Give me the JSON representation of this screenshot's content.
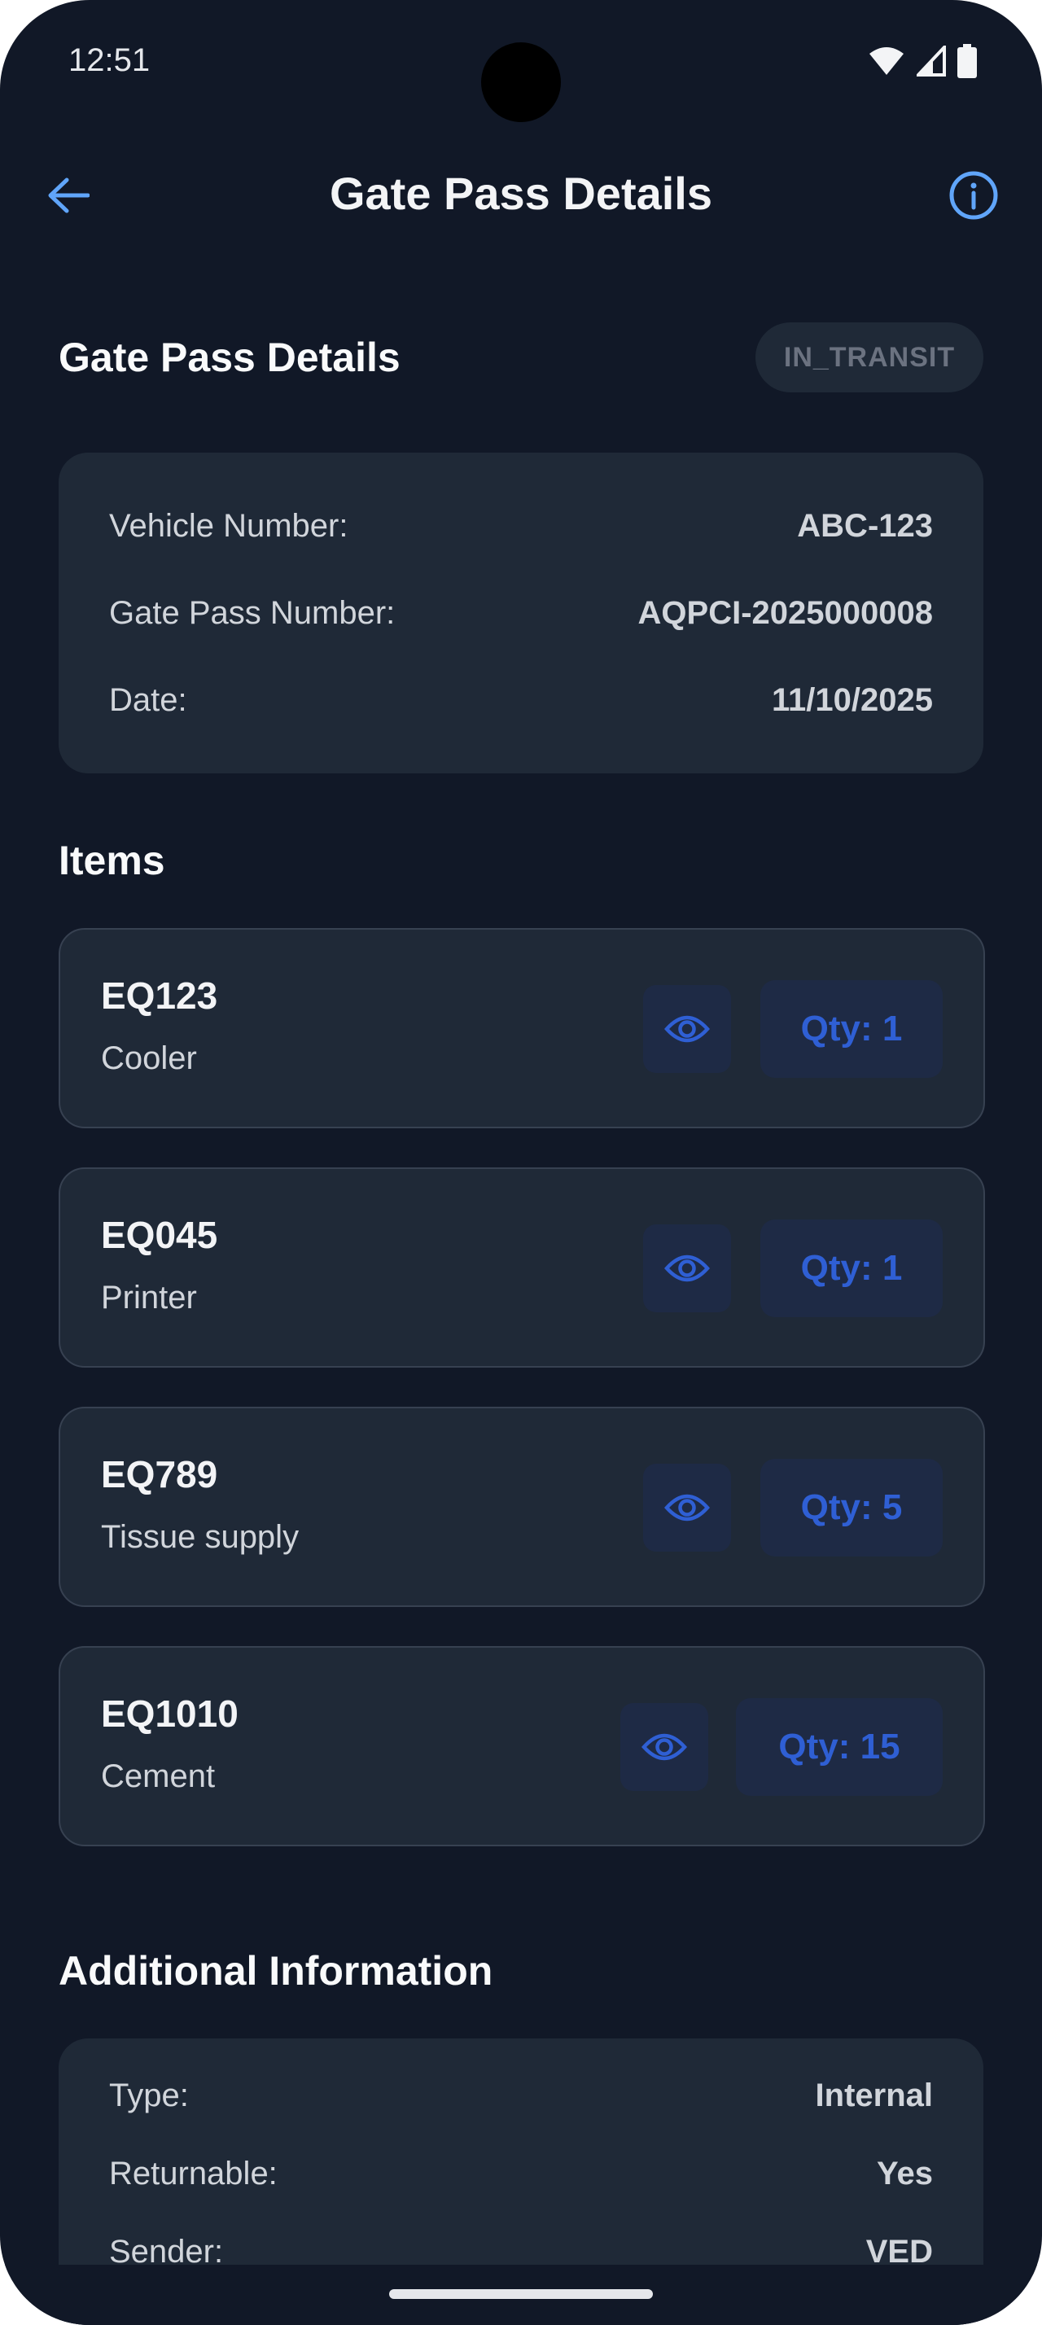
{
  "status_bar": {
    "time": "12:51"
  },
  "app_bar": {
    "title": "Gate Pass Details"
  },
  "header": {
    "title": "Gate Pass Details",
    "status": "IN_TRANSIT"
  },
  "details": [
    {
      "label": "Vehicle Number:",
      "value": "ABC-123"
    },
    {
      "label": "Gate Pass Number:",
      "value": "AQPCI-2025000008"
    },
    {
      "label": "Date:",
      "value": "11/10/2025"
    }
  ],
  "items_section": {
    "title": "Items"
  },
  "items": [
    {
      "code": "EQ123",
      "name": "Cooler",
      "qty": "Qty: 1"
    },
    {
      "code": "EQ045",
      "name": "Printer",
      "qty": "Qty: 1"
    },
    {
      "code": "EQ789",
      "name": "Tissue supply",
      "qty": "Qty: 5"
    },
    {
      "code": "EQ1010",
      "name": "Cement",
      "qty": "Qty: 15"
    }
  ],
  "additional_section": {
    "title": "Additional Information"
  },
  "additional": [
    {
      "label": "Type:",
      "value": "Internal"
    },
    {
      "label": "Returnable:",
      "value": "Yes"
    },
    {
      "label": "Sender:",
      "value": "VED"
    }
  ],
  "colors": {
    "background": "#111827",
    "card": "#1f2937",
    "accent": "#60a5fa",
    "qty_text": "#2f5fd4"
  }
}
